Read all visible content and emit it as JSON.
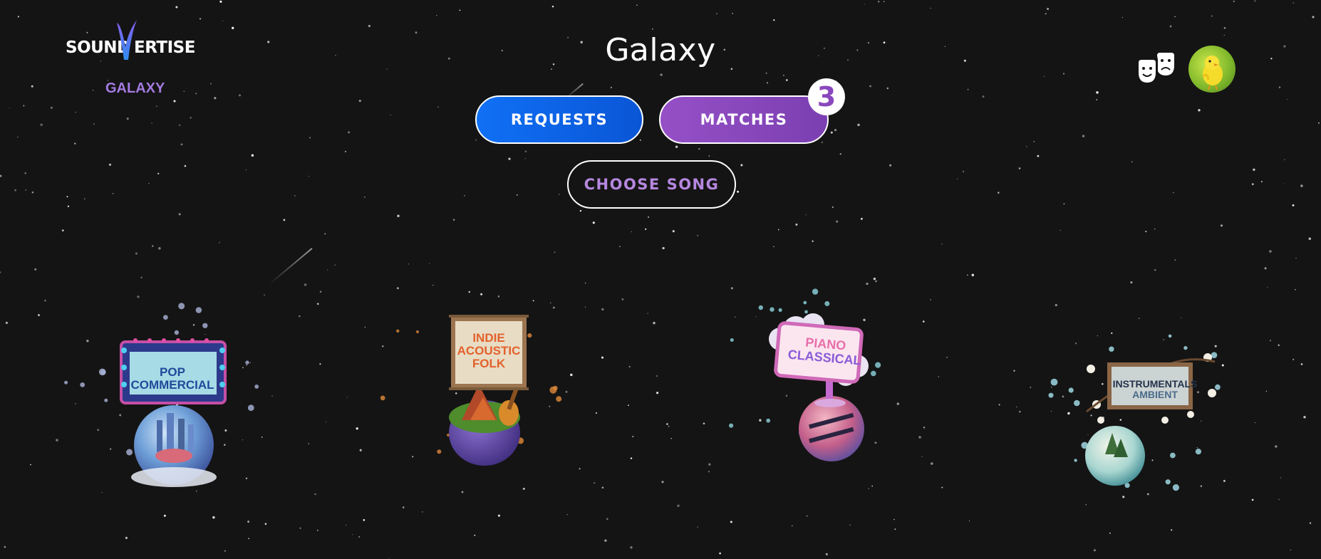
{
  "app": {
    "logo_left": "SOUND",
    "logo_right": "ERTISE",
    "section_label": "GALAXY"
  },
  "header": {
    "title": "Galaxy"
  },
  "actions": {
    "requests_label": "REQUESTS",
    "matches_label": "MATCHES",
    "matches_count": "3",
    "choose_song_label": "CHOOSE SONG"
  },
  "topbar": {
    "masks_icon": "theater-masks-icon",
    "avatar_icon": "user-avatar"
  },
  "planets": [
    {
      "line1": "POP",
      "line2": "COMMERCIAL",
      "line3": "",
      "accent": "#3a8fd6"
    },
    {
      "line1": "INDIE",
      "line2": "ACOUSTIC",
      "line3": "FOLK",
      "accent": "#e8733a"
    },
    {
      "line1": "PIANO",
      "line2": "CLASSICAL",
      "line3": "",
      "accent": "#8a5bd6"
    },
    {
      "line1": "INSTRUMENTALS",
      "line2": "AMBIENT",
      "line3": "",
      "accent": "#2a3f55"
    }
  ],
  "colors": {
    "background": "#141414",
    "requests_blue": "#1070f5",
    "matches_purple": "#8a47bd",
    "label_purple": "#a47be0"
  }
}
